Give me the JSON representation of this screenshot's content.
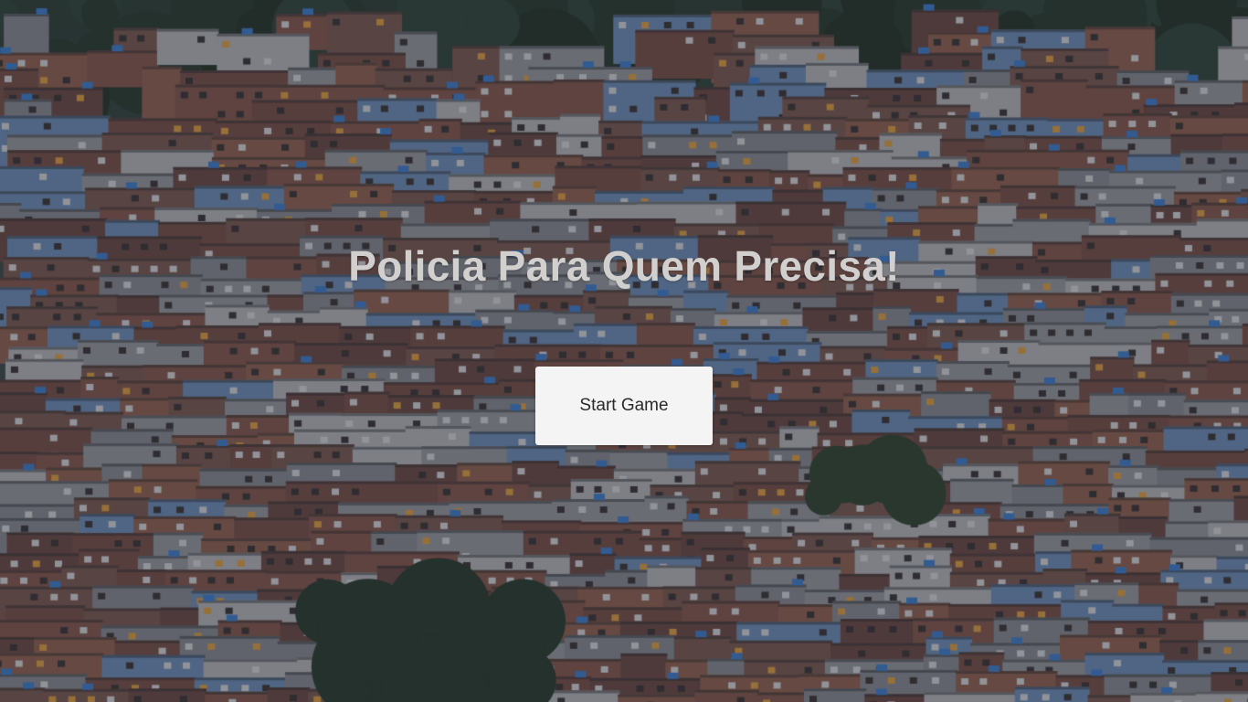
{
  "screen": {
    "title": "Policia Para Quem Precisa!",
    "start_button_label": "Start Game"
  },
  "background": {
    "scene": "hillside-favela-photo",
    "colors": {
      "sky_trees": "#2c3d33",
      "brick": "#7a5048",
      "concrete": "#8c8f95",
      "blue_wall": "#6f8fb8",
      "window_light": "#e0a040"
    }
  }
}
